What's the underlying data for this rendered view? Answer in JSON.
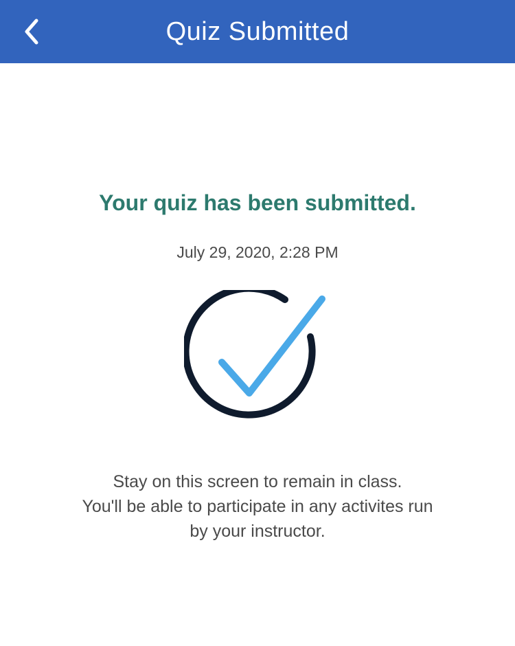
{
  "header": {
    "title": "Quiz Submitted",
    "back_icon": "chevron-left-icon",
    "background_color": "#3264bd"
  },
  "confirmation": {
    "heading": "Your quiz has been submitted.",
    "heading_color": "#2d7a6e",
    "timestamp": "July 29, 2020, 2:28 PM",
    "icon": "circle-check-icon",
    "ring_color": "#0f1b2d",
    "check_color": "#4aa9e8"
  },
  "instructions": {
    "line1": "Stay on this screen to remain in class.",
    "line2": "You'll be able to participate in any activites run",
    "line3": "by your instructor."
  }
}
